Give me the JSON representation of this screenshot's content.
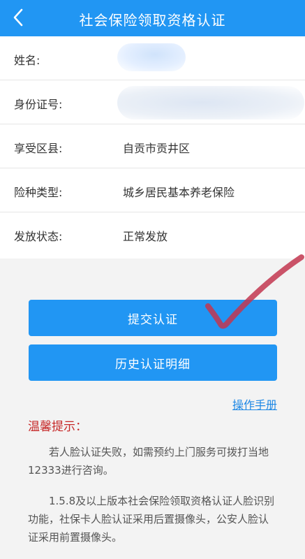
{
  "header": {
    "title": "社会保险领取资格认证",
    "back_icon": "chevron-left-icon"
  },
  "info": {
    "rows": [
      {
        "label": "姓名:",
        "value": ""
      },
      {
        "label": "身份证号:",
        "value": ""
      },
      {
        "label": "享受区县:",
        "value": "自贡市贡井区"
      },
      {
        "label": "险种类型:",
        "value": "城乡居民基本养老保险"
      },
      {
        "label": "发放状态:",
        "value": "正常发放"
      }
    ]
  },
  "buttons": {
    "submit": "提交认证",
    "history": "历史认证明细"
  },
  "manual_link": "操作手册",
  "tips": {
    "title": "温馨提示：",
    "paragraphs": [
      "若人脸认证失败，如需预约上门服务可拨打当地12333进行咨询。",
      "1.5.8及以上版本社会保险领取资格认证人脸识别功能，社保卡人脸认证采用后置摄像头，公安人脸认证采用前置摄像头。"
    ]
  },
  "colors": {
    "primary": "#2196f3",
    "tip_title": "#c62828",
    "link": "#1e88e5",
    "annotation": "#c2364f"
  }
}
